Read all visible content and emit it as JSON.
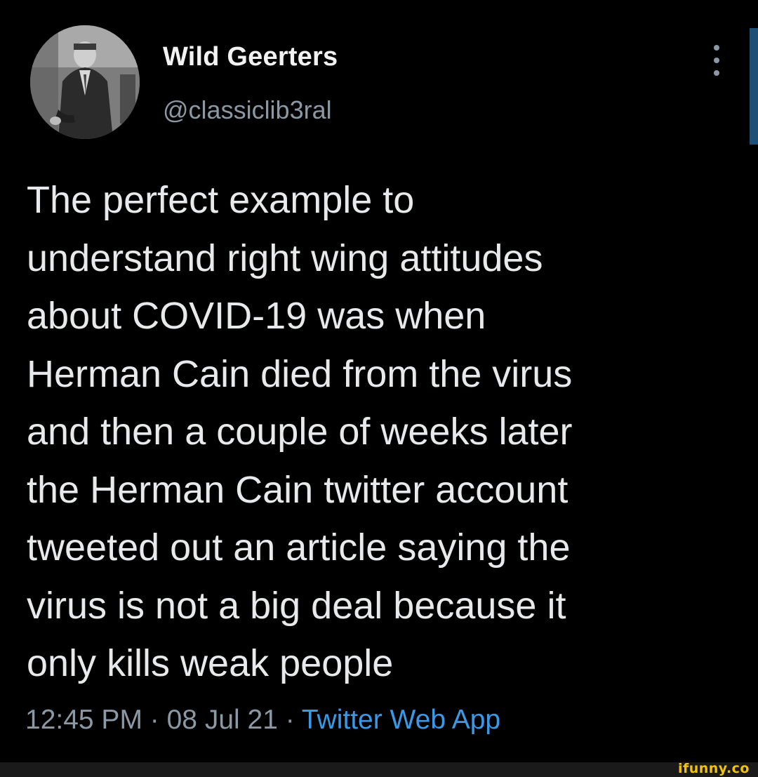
{
  "author": {
    "display_name": "Wild Geerters",
    "handle": "@classiclib3ral",
    "avatar_icon": "profile-photo"
  },
  "tweet": {
    "text": "The perfect example to\nunderstand right wing attitudes\nabout COVID-19 was when\nHerman Cain died from the virus\nand then a couple of weeks later\nthe Herman Cain twitter account\ntweeted out an article saying the\nvirus is not a big deal because it\nonly kills weak people",
    "time": "12:45 PM",
    "separator": " · ",
    "date": "08 Jul 21",
    "source": "Twitter Web App"
  },
  "menu": {
    "icon": "more-vertical-icon"
  },
  "watermark": {
    "text": "ifunny.co"
  },
  "colors": {
    "background": "#000000",
    "text": "#e7e9ea",
    "secondary": "#8b98a5",
    "link": "#3a99e6",
    "watermark": "#f2c300"
  }
}
